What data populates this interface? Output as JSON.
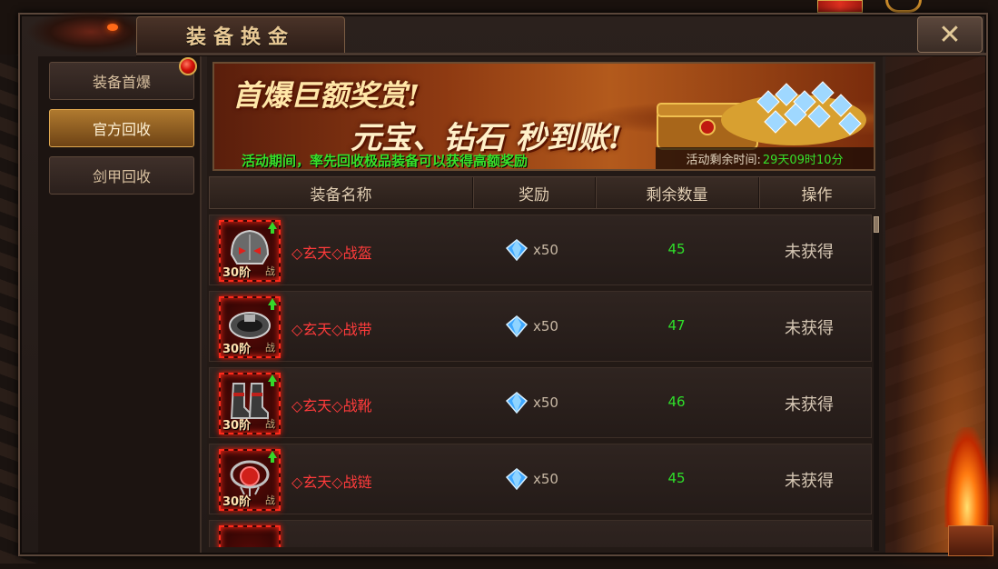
{
  "window": {
    "title": "装备换金",
    "close_glyph": "✕"
  },
  "sidebar": {
    "items": [
      {
        "label": "装备首爆",
        "active": false,
        "has_badge": true
      },
      {
        "label": "官方回收",
        "active": true,
        "has_badge": false
      },
      {
        "label": "剑甲回收",
        "active": false,
        "has_badge": false
      }
    ]
  },
  "banner": {
    "headline_1": "首爆巨额奖赏!",
    "headline_2": "元宝、钻石 秒到账!",
    "subtitle": "活动期间，率先回收极品装备可以获得高额奖励",
    "timer_label": "活动剩余时间:",
    "timer_value": "29天09时10分"
  },
  "table": {
    "headers": [
      "装备名称",
      "奖励",
      "剩余数量",
      "操作"
    ],
    "rows": [
      {
        "icon": "helmet-icon",
        "tier": "30阶",
        "class": "战",
        "name": "◇玄天◇战盔",
        "reward_icon": "diamond-icon",
        "reward_qty": "x50",
        "remaining": "45",
        "action": "未获得"
      },
      {
        "icon": "belt-icon",
        "tier": "30阶",
        "class": "战",
        "name": "◇玄天◇战带",
        "reward_icon": "diamond-icon",
        "reward_qty": "x50",
        "remaining": "47",
        "action": "未获得"
      },
      {
        "icon": "boots-icon",
        "tier": "30阶",
        "class": "战",
        "name": "◇玄天◇战靴",
        "reward_icon": "diamond-icon",
        "reward_qty": "x50",
        "remaining": "46",
        "action": "未获得"
      },
      {
        "icon": "necklace-icon",
        "tier": "30阶",
        "class": "战",
        "name": "◇玄天◇战链",
        "reward_icon": "diamond-icon",
        "reward_qty": "x50",
        "remaining": "45",
        "action": "未获得"
      }
    ]
  },
  "colors": {
    "item_name": "#ff3b3b",
    "remaining": "#2fe02a",
    "banner_subtitle": "#37e02a",
    "active_tab": "#b07a2f"
  }
}
